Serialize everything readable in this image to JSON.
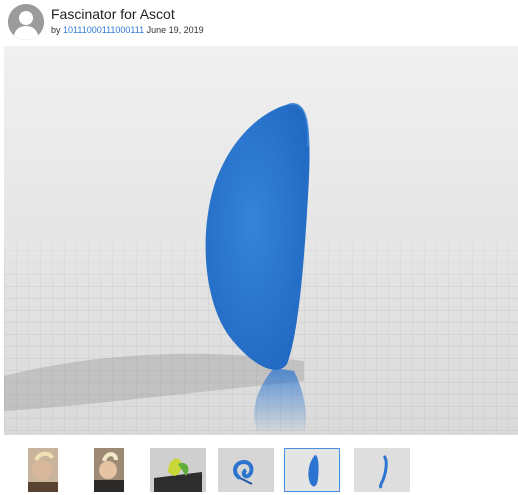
{
  "thing": {
    "title": "Fascinator for Ascot",
    "by_prefix": "by",
    "author": "10111000111000111",
    "date": "June 19, 2019"
  },
  "avatar": {
    "icon": "default-user-icon"
  },
  "viewer": {
    "model_color": "#2b74cf",
    "floor_color": "#d9d9d9",
    "background_color": "#e8e8e8"
  },
  "thumbnails": [
    {
      "name": "photo-worn-1",
      "selected": false
    },
    {
      "name": "photo-worn-2",
      "selected": false
    },
    {
      "name": "render-yellow-green",
      "selected": false
    },
    {
      "name": "render-blue-spiral",
      "selected": false
    },
    {
      "name": "render-blue-disc",
      "selected": true
    },
    {
      "name": "render-blue-curve",
      "selected": false
    }
  ],
  "colors": {
    "link": "#2f7ad9",
    "selected_border": "#4a8fe0"
  }
}
